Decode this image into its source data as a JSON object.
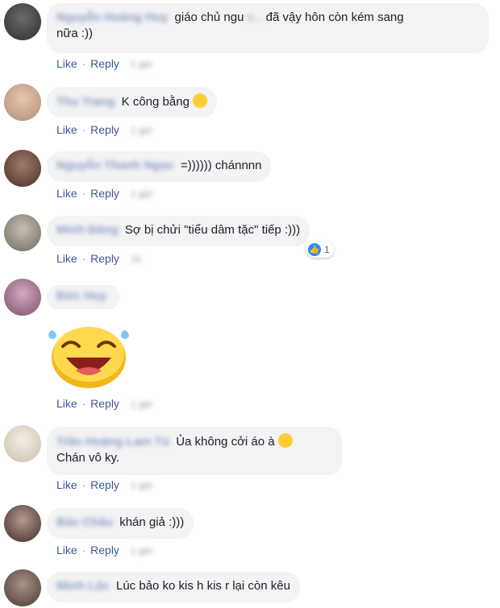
{
  "actions": {
    "like": "Like",
    "reply": "Reply",
    "sep": "·"
  },
  "comments": [
    {
      "name": "Nguyễn Hoàng Huy",
      "text": "giáo chủ ngu",
      "text2": "đã vậy hôn còn kém sang",
      "text3": "nữa :))",
      "time": "1 giờ"
    },
    {
      "name": "Thu Trang",
      "text": "K công bằng",
      "time": "1 giờ"
    },
    {
      "name": "Nguyễn Thanh Ngọc",
      "text": "=)))))) chánnnn",
      "time": "1 giờ"
    },
    {
      "name": "Minh Đăng",
      "text": "Sợ bị chửi \"tiểu dâm tặc\" tiếp :)))",
      "time": "1h",
      "reactions": "1"
    },
    {
      "name": "Đức Huy",
      "time": "1 giờ"
    },
    {
      "name": "Trần Hoàng Lam Tú",
      "text": "Ủa không cởi áo à",
      "text2": "Chán vô ky.",
      "time": "1 giờ"
    },
    {
      "name": "Bảo Châu",
      "text": "khán giả :)))",
      "time": "1 giờ"
    },
    {
      "name": "Minh Lộc",
      "text": "Lúc bảo ko kis h kis r lại còn kêu"
    }
  ],
  "colors": {
    "link": "#385898",
    "bubble": "#f2f3f5",
    "like_badge": "#2d88ff",
    "emoji": "#ffcc33"
  }
}
